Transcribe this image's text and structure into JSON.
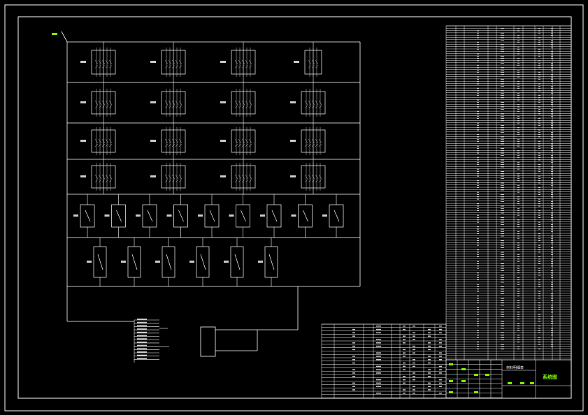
{
  "title_block": {
    "drawing_title": "系统图",
    "drawing_title_color": "#7CFC00",
    "table_caption": "材料明细表"
  },
  "colors": {
    "background": "#000000",
    "lines": "#ffffff",
    "accent": "#7CFC00",
    "glyphs": "#cccccc"
  },
  "diagram": {
    "feeder_rows": [
      {
        "kind": "breaker-block",
        "count": 4
      },
      {
        "kind": "breaker-block",
        "count": 4
      },
      {
        "kind": "breaker-block",
        "count": 4
      },
      {
        "kind": "breaker-block",
        "count": 4
      },
      {
        "kind": "switch",
        "count": 9
      },
      {
        "kind": "switch",
        "count": 6
      }
    ]
  }
}
